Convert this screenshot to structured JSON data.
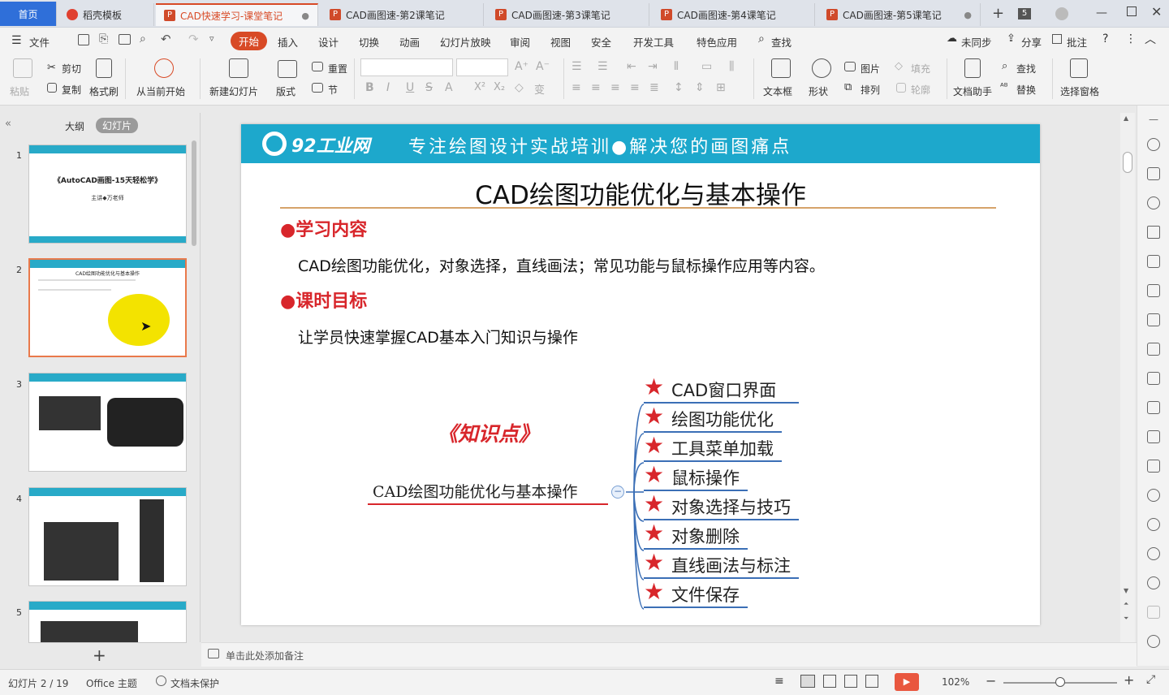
{
  "tabs": [
    {
      "label": "首页"
    },
    {
      "label": "稻壳模板"
    },
    {
      "label": "CAD快速学习-课堂笔记"
    },
    {
      "label": "CAD画图速-第2课笔记"
    },
    {
      "label": "CAD画图速-第3课笔记"
    },
    {
      "label": "CAD画图速-第4课笔记"
    },
    {
      "label": "CAD画图速-第5课笔记"
    }
  ],
  "tab_count": "5",
  "menu": {
    "file": "文件",
    "items": [
      "开始",
      "插入",
      "设计",
      "切换",
      "动画",
      "幻灯片放映",
      "审阅",
      "视图",
      "安全",
      "开发工具",
      "特色应用"
    ],
    "search": "查找",
    "sync": "未同步",
    "share": "分享",
    "comment": "批注"
  },
  "ribbon": {
    "paste": "粘贴",
    "cut": "剪切",
    "copy": "复制",
    "format_painter": "格式刷",
    "play_from_current": "从当前开始",
    "new_slide": "新建幻灯片",
    "layout": "版式",
    "reset": "重置",
    "section": "节",
    "textbox": "文本框",
    "shape": "形状",
    "picture": "图片",
    "fill": "填充",
    "arrange": "排列",
    "outline": "轮廓",
    "doc_helper": "文档助手",
    "find": "查找",
    "replace": "替换",
    "select_pane": "选择窗格"
  },
  "view_tabs": {
    "outline": "大纲",
    "slides": "幻灯片"
  },
  "slide_numbers": [
    "1",
    "2",
    "3",
    "4",
    "5"
  ],
  "thumb1": {
    "title": "《AutoCAD画图-15天轻松学》",
    "lecturer": "主讲◆万老师"
  },
  "thumb2": {
    "title": "CAD绘图功能优化与基本操作"
  },
  "slide": {
    "logo": "92工业网",
    "banner_text": "专注绘图设计实战培训●解决您的画图痛点",
    "title": "CAD绘图功能优化与基本操作",
    "sec1_heading": "●学习内容",
    "sec1_body": "CAD绘图功能优化，对象选择，直线画法；常见功能与鼠标操作应用等内容。",
    "sec2_heading": "●课时目标",
    "sec2_body": "让学员快速掌握CAD基本入门知识与操作",
    "knowledge_label": "《知识点》",
    "mindmap_root": "CAD绘图功能优化与基本操作",
    "mindmap_items": [
      "CAD窗口界面",
      "绘图功能优化",
      "工具菜单加载",
      "鼠标操作",
      "对象选择与技巧",
      "对象删除",
      "直线画法与标注",
      "文件保存"
    ]
  },
  "notes_placeholder": "单击此处添加备注",
  "status": {
    "slide_counter": "幻灯片 2 / 19",
    "theme": "Office 主题",
    "protection": "文档未保护",
    "zoom": "102%"
  },
  "colors": {
    "accent": "#d84a26",
    "banner": "#1da8cc",
    "heading_red": "#d8262b",
    "tab_home": "#2f6fd9"
  }
}
